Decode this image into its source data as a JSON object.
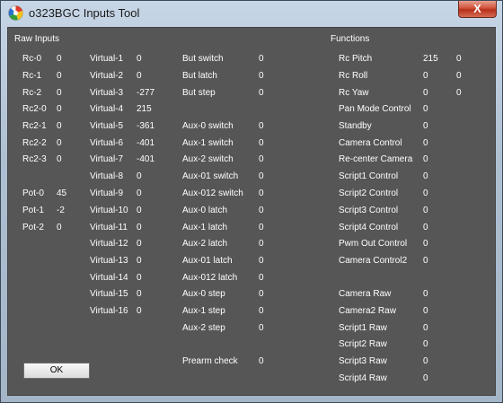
{
  "window": {
    "title": "o323BGC Inputs Tool",
    "close_label": "X"
  },
  "headers": {
    "raw_inputs": "Raw Inputs",
    "functions": "Functions"
  },
  "raw_inputs": [
    {
      "label": "Rc-0",
      "value": "0"
    },
    {
      "label": "Rc-1",
      "value": "0"
    },
    {
      "label": "Rc-2",
      "value": "0"
    },
    {
      "label": "Rc2-0",
      "value": "0"
    },
    {
      "label": "Rc2-1",
      "value": "0"
    },
    {
      "label": "Rc2-2",
      "value": "0"
    },
    {
      "label": "Rc2-3",
      "value": "0"
    }
  ],
  "pots": [
    {
      "label": "Pot-0",
      "value": "45"
    },
    {
      "label": "Pot-1",
      "value": "-2"
    },
    {
      "label": "Pot-2",
      "value": "0"
    }
  ],
  "virtuals": [
    {
      "label": "Virtual-1",
      "value": "0"
    },
    {
      "label": "Virtual-2",
      "value": "0"
    },
    {
      "label": "Virtual-3",
      "value": "-277"
    },
    {
      "label": "Virtual-4",
      "value": "215"
    },
    {
      "label": "Virtual-5",
      "value": "-361"
    },
    {
      "label": "Virtual-6",
      "value": "-401"
    },
    {
      "label": "Virtual-7",
      "value": "-401"
    },
    {
      "label": "Virtual-8",
      "value": "0"
    },
    {
      "label": "Virtual-9",
      "value": "0"
    },
    {
      "label": "Virtual-10",
      "value": "0"
    },
    {
      "label": "Virtual-11",
      "value": "0"
    },
    {
      "label": "Virtual-12",
      "value": "0"
    },
    {
      "label": "Virtual-13",
      "value": "0"
    },
    {
      "label": "Virtual-14",
      "value": "0"
    },
    {
      "label": "Virtual-15",
      "value": "0"
    },
    {
      "label": "Virtual-16",
      "value": "0"
    }
  ],
  "buttons": [
    {
      "label": "But switch",
      "value": "0"
    },
    {
      "label": "But latch",
      "value": "0"
    },
    {
      "label": "But step",
      "value": "0"
    }
  ],
  "aux": [
    {
      "label": "Aux-0 switch",
      "value": "0"
    },
    {
      "label": "Aux-1 switch",
      "value": "0"
    },
    {
      "label": "Aux-2 switch",
      "value": "0"
    },
    {
      "label": "Aux-01 switch",
      "value": "0"
    },
    {
      "label": "Aux-012 switch",
      "value": "0"
    },
    {
      "label": "Aux-0 latch",
      "value": "0"
    },
    {
      "label": "Aux-1 latch",
      "value": "0"
    },
    {
      "label": "Aux-2 latch",
      "value": "0"
    },
    {
      "label": "Aux-01 latch",
      "value": "0"
    },
    {
      "label": "Aux-012 latch",
      "value": "0"
    },
    {
      "label": "Aux-0 step",
      "value": "0"
    },
    {
      "label": "Aux-1 step",
      "value": "0"
    },
    {
      "label": "Aux-2 step",
      "value": "0"
    }
  ],
  "prearm": {
    "label": "Prearm check",
    "value": "0"
  },
  "functions": [
    {
      "label": "Rc Pitch",
      "value": "215",
      "value2": "0"
    },
    {
      "label": "Rc Roll",
      "value": "0",
      "value2": "0"
    },
    {
      "label": "Rc Yaw",
      "value": "0",
      "value2": "0"
    },
    {
      "label": "Pan Mode Control",
      "value": "0"
    },
    {
      "label": "Standby",
      "value": "0"
    },
    {
      "label": "Camera Control",
      "value": "0"
    },
    {
      "label": "Re-center Camera",
      "value": "0"
    },
    {
      "label": "Script1 Control",
      "value": "0"
    },
    {
      "label": "Script2 Control",
      "value": "0"
    },
    {
      "label": "Script3 Control",
      "value": "0"
    },
    {
      "label": "Script4 Control",
      "value": "0"
    },
    {
      "label": "Pwm Out Control",
      "value": "0"
    },
    {
      "label": "Camera Control2",
      "value": "0"
    }
  ],
  "raw_functions": [
    {
      "label": "Camera Raw",
      "value": "0"
    },
    {
      "label": "Camera2 Raw",
      "value": "0"
    },
    {
      "label": "Script1 Raw",
      "value": "0"
    },
    {
      "label": "Script2 Raw",
      "value": "0"
    },
    {
      "label": "Script3 Raw",
      "value": "0"
    },
    {
      "label": "Script4 Raw",
      "value": "0"
    }
  ],
  "ok_label": "OK"
}
